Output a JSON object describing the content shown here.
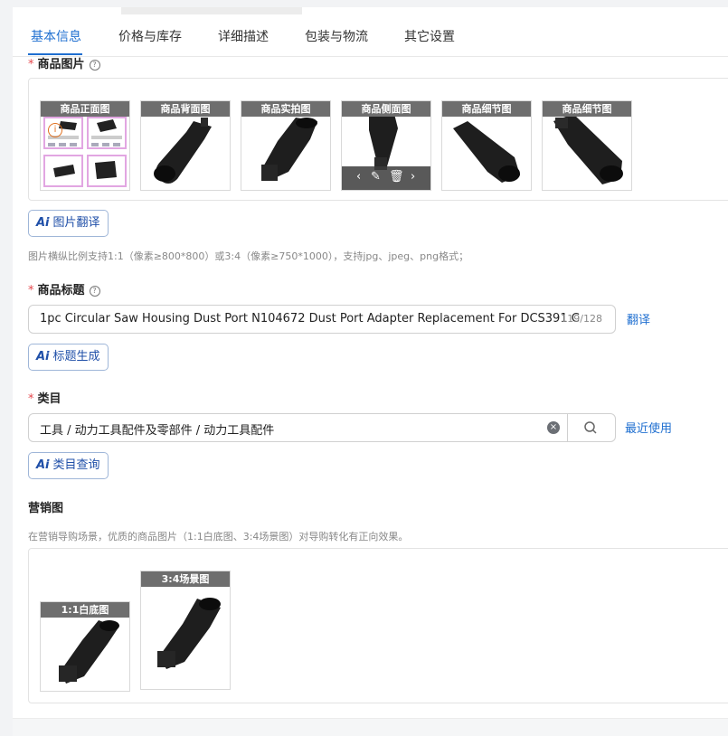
{
  "tabs": [
    "基本信息",
    "价格与库存",
    "详细描述",
    "包装与物流",
    "其它设置"
  ],
  "product_images": {
    "required_mark": "*",
    "label": "商品图片",
    "help_icon": "question-circle-icon",
    "tiles": [
      {
        "caption": "商品正面图",
        "badge_icon": "warning-circle-icon"
      },
      {
        "caption": "商品背面图"
      },
      {
        "caption": "商品实拍图"
      },
      {
        "caption": "商品侧面图",
        "actions": [
          "chevron-left-icon",
          "edit-icon",
          "trash-icon",
          "chevron-right-icon"
        ]
      },
      {
        "caption": "商品细节图"
      },
      {
        "caption": "商品细节图"
      }
    ],
    "ai_button": {
      "icon": "Ai",
      "label": "图片翻译"
    },
    "hint": "图片横纵比例支持1:1（像素≥800*800）或3:4（像素≥750*1000），支持jpg、jpeg、png格式；"
  },
  "title_field": {
    "required_mark": "*",
    "label": "商品标题",
    "value": "1pc Circular Saw Housing Dust Port N104672 Dust Port Adapter Replacement For DCS391 C",
    "counter": "119/128",
    "translate_link": "翻译",
    "ai_button": {
      "icon": "Ai",
      "label": "标题生成"
    }
  },
  "category_field": {
    "required_mark": "*",
    "label": "类目",
    "value": "工具 / 动力工具配件及零部件 / 动力工具配件",
    "recent_link": "最近使用",
    "ai_button": {
      "icon": "Ai",
      "label": "类目查询"
    }
  },
  "marketing": {
    "label": "营销图",
    "hint": "在营销导购场景，优质的商品图片（1:1白底图、3:4场景图）对导购转化有正向效果。",
    "tiles": [
      {
        "caption": "1:1白底图"
      },
      {
        "caption": "3:4场景图"
      }
    ]
  },
  "colors": {
    "accent": "#1f6fd0",
    "required": "#e5484d",
    "caption_bg": "#6e6e6e"
  }
}
